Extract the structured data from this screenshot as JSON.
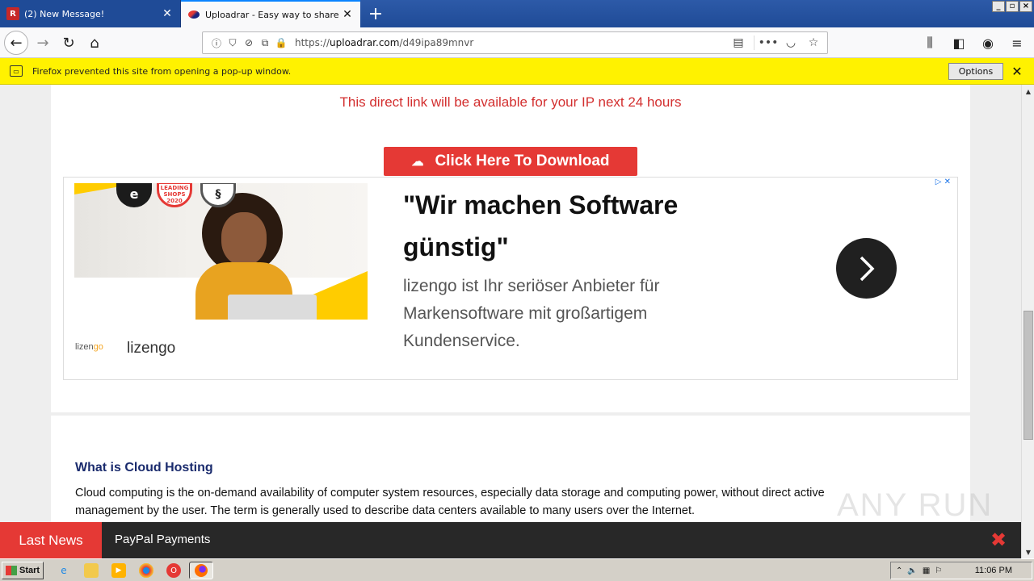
{
  "browser": {
    "tabs": [
      {
        "title": "(2) New Message!",
        "active": false
      },
      {
        "title": "Uploadrar - Easy way to share your files",
        "active": true
      }
    ],
    "url": "https://uploadrar.com/d49ipa89mnvr",
    "url_domain": "uploadrar.com",
    "url_path": "/d49ipa89mnvr",
    "url_scheme": "https://",
    "window_buttons": [
      "_",
      "▫",
      "×"
    ]
  },
  "notification": {
    "message": "Firefox prevented this site from opening a pop-up window.",
    "options_label": "Options"
  },
  "page": {
    "ip_note": "This direct link will be available for your IP next 24 hours",
    "download_label": "Click Here To Download",
    "ad": {
      "headline": "\"Wir machen Software günstig\"",
      "description": "lizengo ist Ihr seriöser Anbieter für Markensoftware mit großartigem Kundenservice.",
      "brand_logo_text": "lizen",
      "brand_logo_suffix": "go",
      "brand_name": "lizengo",
      "seal_badges": [
        "e",
        "LEADING SHOPS 2020",
        "§"
      ]
    },
    "section_title": "What is Cloud Hosting",
    "section_body": "Cloud computing is the on-demand availability of computer system resources, especially data storage and computing power, without direct active management by the user. The term is generally used to describe data centers available to many users over the Internet."
  },
  "ticker": {
    "label": "Last News",
    "item": "PayPal Payments"
  },
  "watermark": "ANY RUN",
  "taskbar": {
    "start_label": "Start",
    "clock": "11:06 PM"
  }
}
